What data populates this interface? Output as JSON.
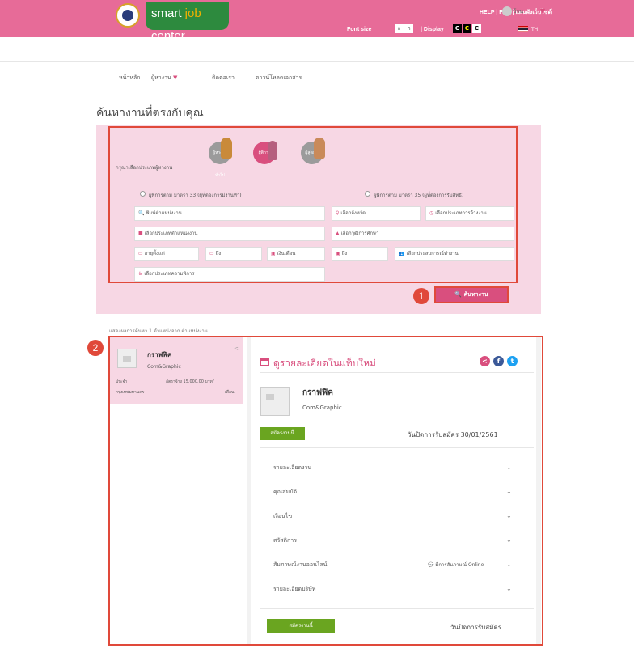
{
  "header": {
    "brand_prefix": "smart ",
    "brand_accent": "job",
    "brand_suffix": " center",
    "links": "HELP | FAQ | แผนผังเว็บไซต์",
    "font_size_label": "Font size",
    "font_sizes": [
      "ก",
      "ก",
      "ก"
    ],
    "display_label": "| Display",
    "display_options": [
      "C",
      "C",
      "C"
    ],
    "language": "TH",
    "user_name": "บ้าน"
  },
  "nav": [
    "หน้าหลัก",
    "ผู้หางาน",
    "ติดต่อเรา",
    "ดาวน์โหลดเอกสาร"
  ],
  "page_title": "ค้นหางานที่ตรงกับคุณ",
  "search": {
    "type_label": "กรุณาเลือกประเภทผู้หางาน",
    "types": [
      "ผู้หางานทั่วไป",
      "ผู้พิการ",
      "ผู้สูงอายุ"
    ],
    "radio1": "ผู้พิการตาม มาตรา 33 (ผู้ที่ต้องการมีงานทำ)",
    "radio2": "ผู้พิการตาม มาตรา 35 (ผู้ที่ต้องการรับสิทธิ)",
    "position": "พิมพ์ตำแหน่งงาน",
    "province": "เลือกจังหวัด",
    "employment_type": "เลือกประเภทการจ้างงาน",
    "job_type": "เลือกประเภทตำแหน่งงาน",
    "education": "เลือกวุฒิการศึกษา",
    "age_from": "อายุตั้งแต่",
    "age_to": "ถึง",
    "salary_from": "เงินเดือน",
    "salary_to": "ถึง",
    "experience": "เลือกประสบการณ์ทำงาน",
    "disability": "เลือกประเภทความพิการ",
    "button": "ค้นหางาน"
  },
  "markers": [
    "1",
    "2"
  ],
  "results_note": "แสดงผลการค้นหา 1 ตำแหน่งจาก ตำแหน่งงาน",
  "result_card": {
    "title": "กราฟฟิค",
    "company": "Com&Graphic",
    "location_label": "ประจำ",
    "salary": "อัตราจ้าง 15,000.00 บาท/",
    "province": "กรุงเทพมหานคร",
    "period": "เดือน"
  },
  "detail": {
    "heading": "ดูรายละเอียดในแท็บใหม่",
    "title": "กราฟฟิค",
    "company": "Com&Graphic",
    "apply_label": "สมัครงานนี้",
    "closing_date": "วันปิดการรับสมัคร 30/01/2561",
    "closing_label_bottom": "วันปิดการรับสมัคร",
    "sections": [
      "รายละเอียดงาน",
      "คุณสมบัติ",
      "เงื่อนไข",
      "สวัสดิการ",
      "สัมภาษณ์งานออนไลน์",
      "รายละเอียดบริษัท"
    ],
    "interview_note": "มีการสัมภาษณ์ Online"
  },
  "colors": {
    "pink": "#e76b98",
    "accent": "#d94f7e",
    "green": "#6aa520",
    "marker": "#e0493a"
  }
}
